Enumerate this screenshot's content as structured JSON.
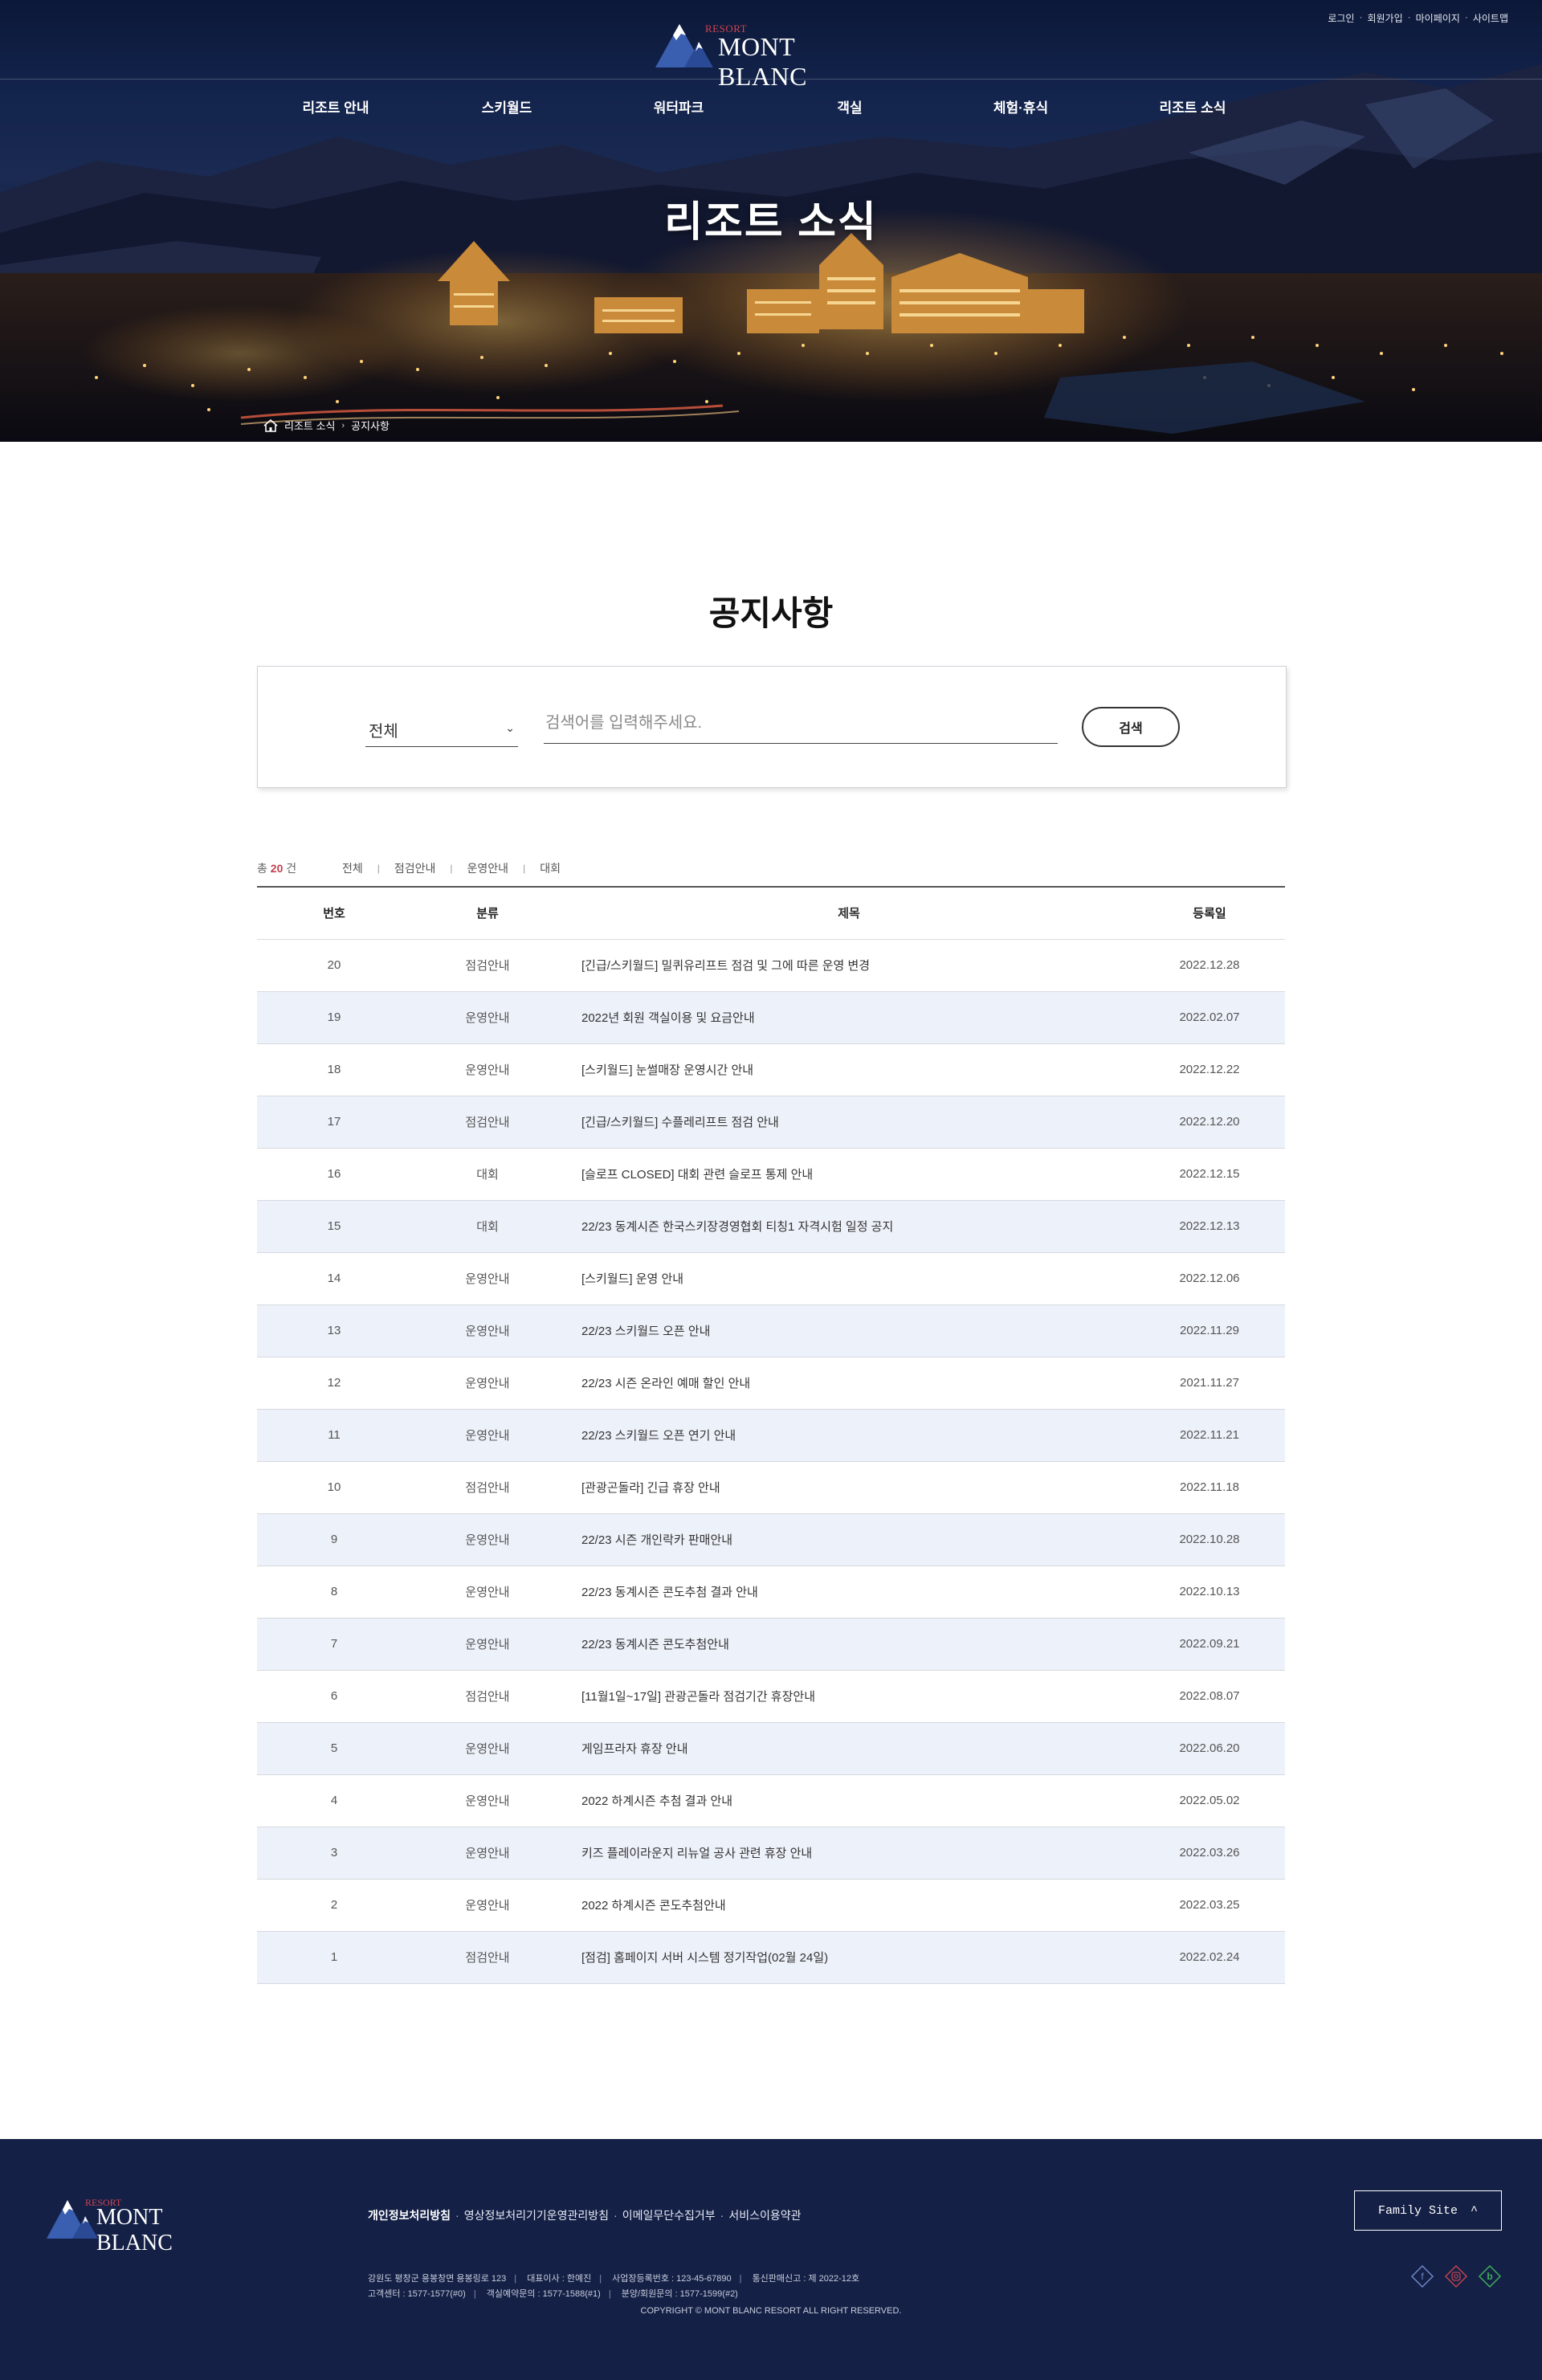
{
  "util_links": [
    "로그인",
    "회원가입",
    "마이페이지",
    "사이트맵"
  ],
  "logo": {
    "small": "RESORT",
    "name": "MONT BLANC"
  },
  "nav": [
    "리조트 안내",
    "스키월드",
    "워터파크",
    "객실",
    "체험·휴식",
    "리조트 소식"
  ],
  "hero": {
    "title": "리조트 소식"
  },
  "breadcrumb": {
    "home_icon": "home-icon",
    "items": [
      "리조트 소식",
      "공지사항"
    ]
  },
  "page": {
    "title": "공지사항"
  },
  "search": {
    "select_value": "전체",
    "placeholder": "검색어를 입력해주세요.",
    "button": "검색"
  },
  "summary": {
    "prefix": "총",
    "count": "20",
    "suffix": "건"
  },
  "filters": [
    "전체",
    "점검안내",
    "운영안내",
    "대회"
  ],
  "table": {
    "headers": {
      "no": "번호",
      "category": "분류",
      "title": "제목",
      "date": "등록일"
    },
    "rows": [
      {
        "no": "20",
        "category": "점검안내",
        "title": "[긴급/스키월드] 밀퀴유리프트 점검 및 그에 따른 운영 변경",
        "date": "2022.12.28"
      },
      {
        "no": "19",
        "category": "운영안내",
        "title": "2022년 회원 객실이용 및 요금안내",
        "date": "2022.02.07"
      },
      {
        "no": "18",
        "category": "운영안내",
        "title": "[스키월드] 눈썰매장 운영시간 안내",
        "date": "2022.12.22"
      },
      {
        "no": "17",
        "category": "점검안내",
        "title": "[긴급/스키월드] 수플레리프트 점검 안내",
        "date": "2022.12.20"
      },
      {
        "no": "16",
        "category": "대회",
        "title": "[슬로프 CLOSED] 대회 관련 슬로프 통제 안내",
        "date": "2022.12.15"
      },
      {
        "no": "15",
        "category": "대회",
        "title": "22/23 동계시즌 한국스키장경영협회 티칭1 자격시험 일정 공지",
        "date": "2022.12.13"
      },
      {
        "no": "14",
        "category": "운영안내",
        "title": "[스키월드] 운영 안내",
        "date": "2022.12.06"
      },
      {
        "no": "13",
        "category": "운영안내",
        "title": "22/23 스키월드 오픈 안내",
        "date": "2022.11.29"
      },
      {
        "no": "12",
        "category": "운영안내",
        "title": "22/23 시즌 온라인 예매 할인 안내",
        "date": "2021.11.27"
      },
      {
        "no": "11",
        "category": "운영안내",
        "title": "22/23 스키월드 오픈 연기 안내",
        "date": "2022.11.21"
      },
      {
        "no": "10",
        "category": "점검안내",
        "title": "[관광곤돌라] 긴급 휴장 안내",
        "date": "2022.11.18"
      },
      {
        "no": "9",
        "category": "운영안내",
        "title": "22/23 시즌 개인락카 판매안내",
        "date": "2022.10.28"
      },
      {
        "no": "8",
        "category": "운영안내",
        "title": "22/23 동계시즌 콘도추첨 결과 안내",
        "date": "2022.10.13"
      },
      {
        "no": "7",
        "category": "운영안내",
        "title": "22/23 동계시즌 콘도추첨안내",
        "date": "2022.09.21"
      },
      {
        "no": "6",
        "category": "점검안내",
        "title": "[11월1일~17일] 관광곤돌라 점검기간 휴장안내",
        "date": "2022.08.07"
      },
      {
        "no": "5",
        "category": "운영안내",
        "title": "게임프라자 휴장 안내",
        "date": "2022.06.20"
      },
      {
        "no": "4",
        "category": "운영안내",
        "title": "2022 하계시즌 추첨 결과 안내",
        "date": "2022.05.02"
      },
      {
        "no": "3",
        "category": "운영안내",
        "title": "키즈 플레이라운지 리뉴얼 공사 관련 휴장 안내",
        "date": "2022.03.26"
      },
      {
        "no": "2",
        "category": "운영안내",
        "title": "2022 하계시즌 콘도추첨안내",
        "date": "2022.03.25"
      },
      {
        "no": "1",
        "category": "점검안내",
        "title": "[점검] 홈페이지 서버 시스템 정기작업(02월 24일)",
        "date": "2022.02.24"
      }
    ]
  },
  "footer": {
    "links": [
      "개인정보처리방침",
      "영상정보처리기기운영관리방침",
      "이메일무단수집거부",
      "서비스이용약관"
    ],
    "info_line1": [
      "강원도 평창군 용봉창면 용봉링로 123",
      "대표이사 : 한예진",
      "사업장등록번호 : 123-45-67890",
      "통신판매신고 : 제 2022-12호"
    ],
    "info_line2": [
      "고객센터 : 1577-1577(#0)",
      "객실예약문의 : 1577-1588(#1)",
      "분양/회원문의 : 1577-1599(#2)"
    ],
    "copyright": "COPYRIGHT © MONT BLANC RESORT ALL RIGHT RESERVED.",
    "family_site": "Family Site",
    "social": [
      "facebook-icon",
      "instagram-icon",
      "blog-icon"
    ]
  },
  "colors": {
    "navy": "#142046",
    "accent": "#c0424f",
    "row_alt": "#edf1f9"
  }
}
